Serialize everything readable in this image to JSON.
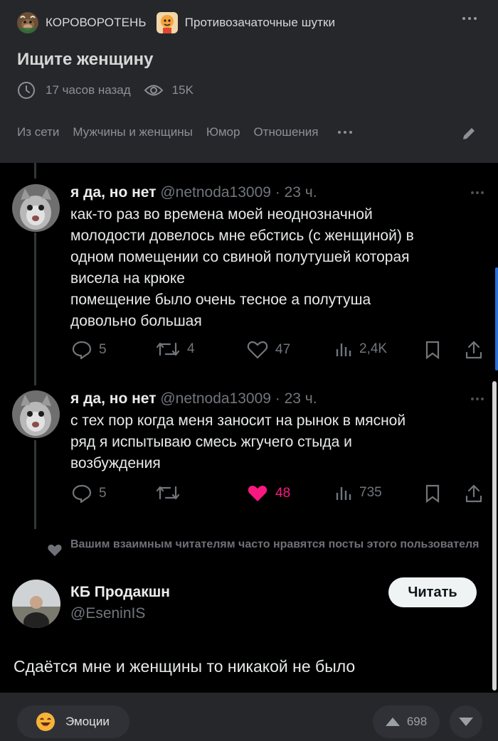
{
  "header": {
    "community_name": "КОРОВОРОТЕНЬ",
    "community_icon": "cow-avatar",
    "subcommunity_name": "Противозачаточные шутки",
    "subcommunity_icon": "cartoon-avatar",
    "more_icon": "more-dots-icon",
    "post_title": "Ищите женщину",
    "time_ago": "17 часов назад",
    "views": "15K",
    "tags": [
      "Из сети",
      "Мужчины и женщины",
      "Юмор",
      "Отношения"
    ],
    "edit_icon": "pencil-icon"
  },
  "screenshot": {
    "tweets": [
      {
        "name": "я да, но нет",
        "handle": "@netnoda13009 · 23 ч.",
        "lines": [
          "как-то раз во времена моей неоднозначной",
          "молодости довелось мне ебстись (с женщиной) в",
          "одном помещении со свиной полутушей которая",
          "висела на крюке",
          "помещение было очень тесное а полутуша",
          "довольно большая"
        ],
        "replies": "5",
        "retweets": "4",
        "likes": "47",
        "views": "2,4K"
      },
      {
        "name": "я да, но нет",
        "handle": "@netnoda13009 · 23 ч.",
        "lines": [
          "с тех пор когда меня заносит на рынок в мясной",
          "ряд я  испытываю смесь жгучего стыда и",
          "возбуждения"
        ],
        "replies": "5",
        "retweets": "",
        "likes": "48",
        "views": "735",
        "liked_color": "#f91880"
      }
    ],
    "suggestion_text": "Вашим взаимным читателям часто нравятся посты этого пользователя",
    "suggested_user": {
      "name": "КБ Продакшн",
      "handle": "@EseninIS",
      "follow_label": "Читать",
      "text": "Сдаётся мне и женщины то никакой не было"
    }
  },
  "footer": {
    "emotions_label": "Эмоции",
    "emotions_icon": "laughing-emoji-icon",
    "rating": "698"
  },
  "colors": {
    "page_bg": "#25272b",
    "tweet_bg": "#000000",
    "like_pink": "#f91880",
    "muted": "#71767b"
  }
}
